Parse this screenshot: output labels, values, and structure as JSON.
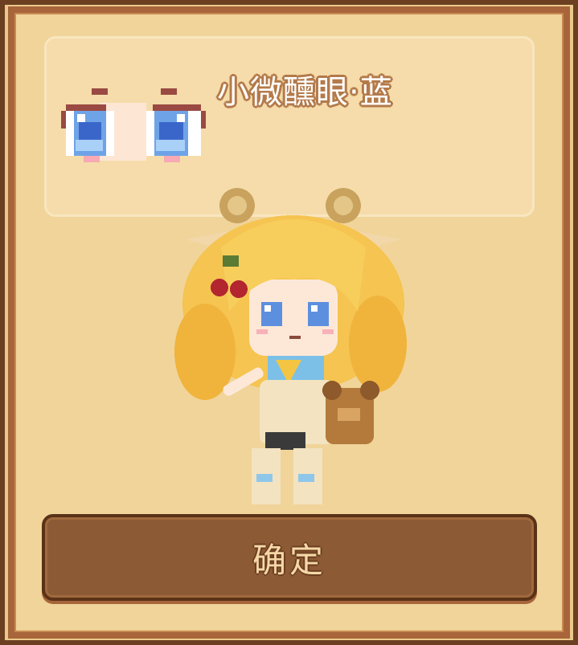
{
  "dialog": {
    "item_name": "小微醺眼·蓝",
    "item_icon": "blue-eyes-icon",
    "preview": "character-preview",
    "confirm_label": "确定"
  },
  "colors": {
    "panel_bg": "#f0d49a",
    "card_bg": "#f5dcaa",
    "frame": "#a8643a",
    "button_bg": "#8c5a35",
    "button_text": "#f6d8a8"
  }
}
